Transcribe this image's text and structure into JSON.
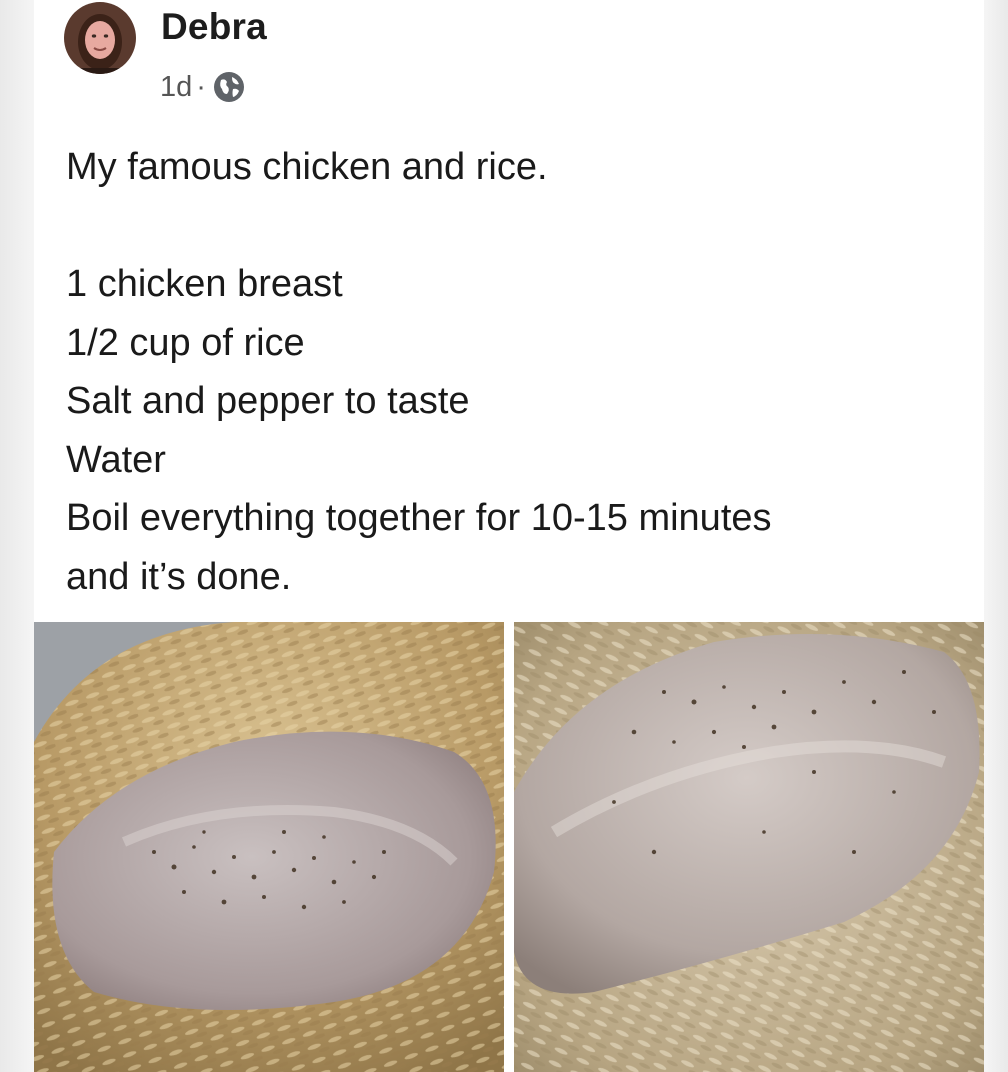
{
  "post": {
    "author": "Debra",
    "time": "1d",
    "separator": "·",
    "visibility_icon": "globe-icon",
    "text_lines": [
      "My famous chicken and rice.",
      "",
      "1 chicken breast",
      "1/2 cup of rice",
      "Salt and pepper to taste",
      "Water",
      "Boil everything together for 10-15 minutes",
      "and it’s done."
    ]
  },
  "photos": [
    {
      "name": "chicken-rice-photo-1"
    },
    {
      "name": "chicken-rice-photo-2"
    }
  ]
}
